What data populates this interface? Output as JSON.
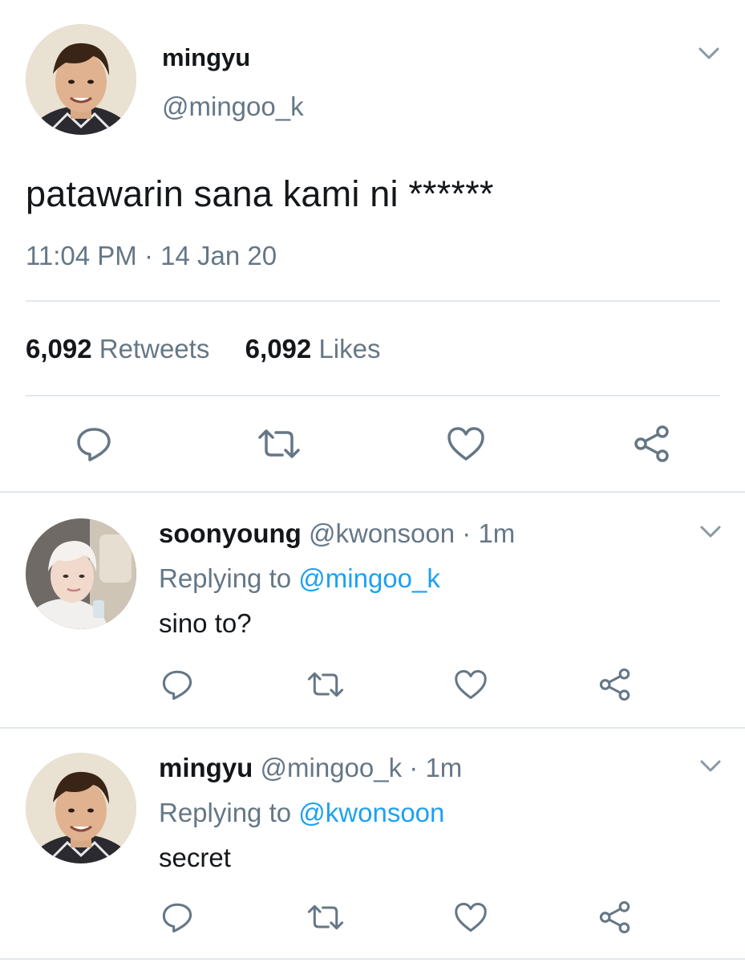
{
  "main_tweet": {
    "author_name": "mingyu",
    "author_handle": "@mingoo_k",
    "text": "patawarin sana kami ni ******",
    "time": "11:04 PM",
    "date": "14 Jan 20",
    "separator": "·",
    "retweets_count": "6,092",
    "retweets_label": "Retweets",
    "likes_count": "6,092",
    "likes_label": "Likes"
  },
  "replies": [
    {
      "author_name": "soonyoung",
      "author_handle": "@kwonsoon",
      "separator": "·",
      "age": "1m",
      "replying_prefix": "Replying to",
      "replying_mention": "@mingoo_k",
      "text": "sino to?"
    },
    {
      "author_name": "mingyu",
      "author_handle": "@mingoo_k",
      "separator": "·",
      "age": "1m",
      "replying_prefix": "Replying to",
      "replying_mention": "@kwonsoon",
      "text": "secret"
    }
  ],
  "icons": {
    "reply": "speech-bubble",
    "retweet": "retweet-arrows",
    "like": "heart-outline",
    "share": "share-nodes",
    "menu": "chevron-down"
  },
  "colors": {
    "text_primary": "#14171a",
    "text_secondary": "#657786",
    "mention_blue": "#1da1f2",
    "divider": "#e1e8ed",
    "icon_gray": "#657786"
  }
}
